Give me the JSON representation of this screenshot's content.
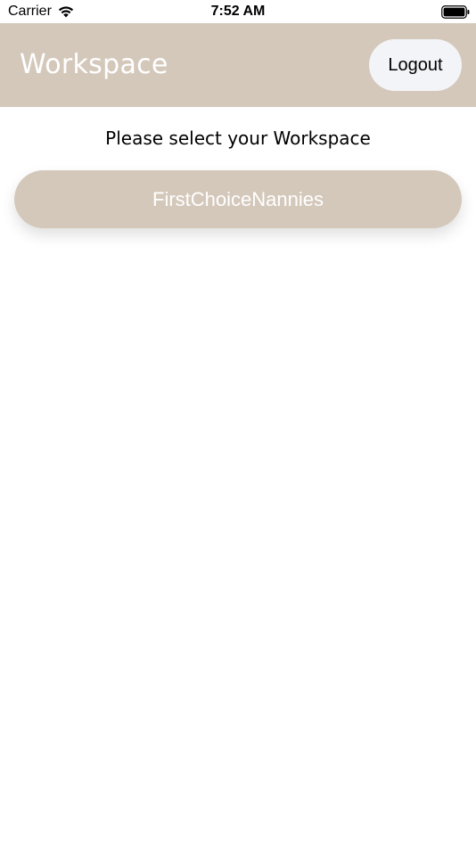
{
  "status_bar": {
    "carrier": "Carrier",
    "time": "7:52 AM",
    "wifi_icon": "wifi-icon",
    "battery_icon": "battery-full-icon"
  },
  "header": {
    "title": "Workspace",
    "logout_label": "Logout",
    "background_color": "#d4c8bb"
  },
  "main": {
    "prompt": "Please select your Workspace",
    "workspaces": [
      {
        "name": "FirstChoiceNannies"
      }
    ]
  },
  "colors": {
    "brand": "#d4c8bb",
    "logout_bg": "#f3f4f8"
  }
}
